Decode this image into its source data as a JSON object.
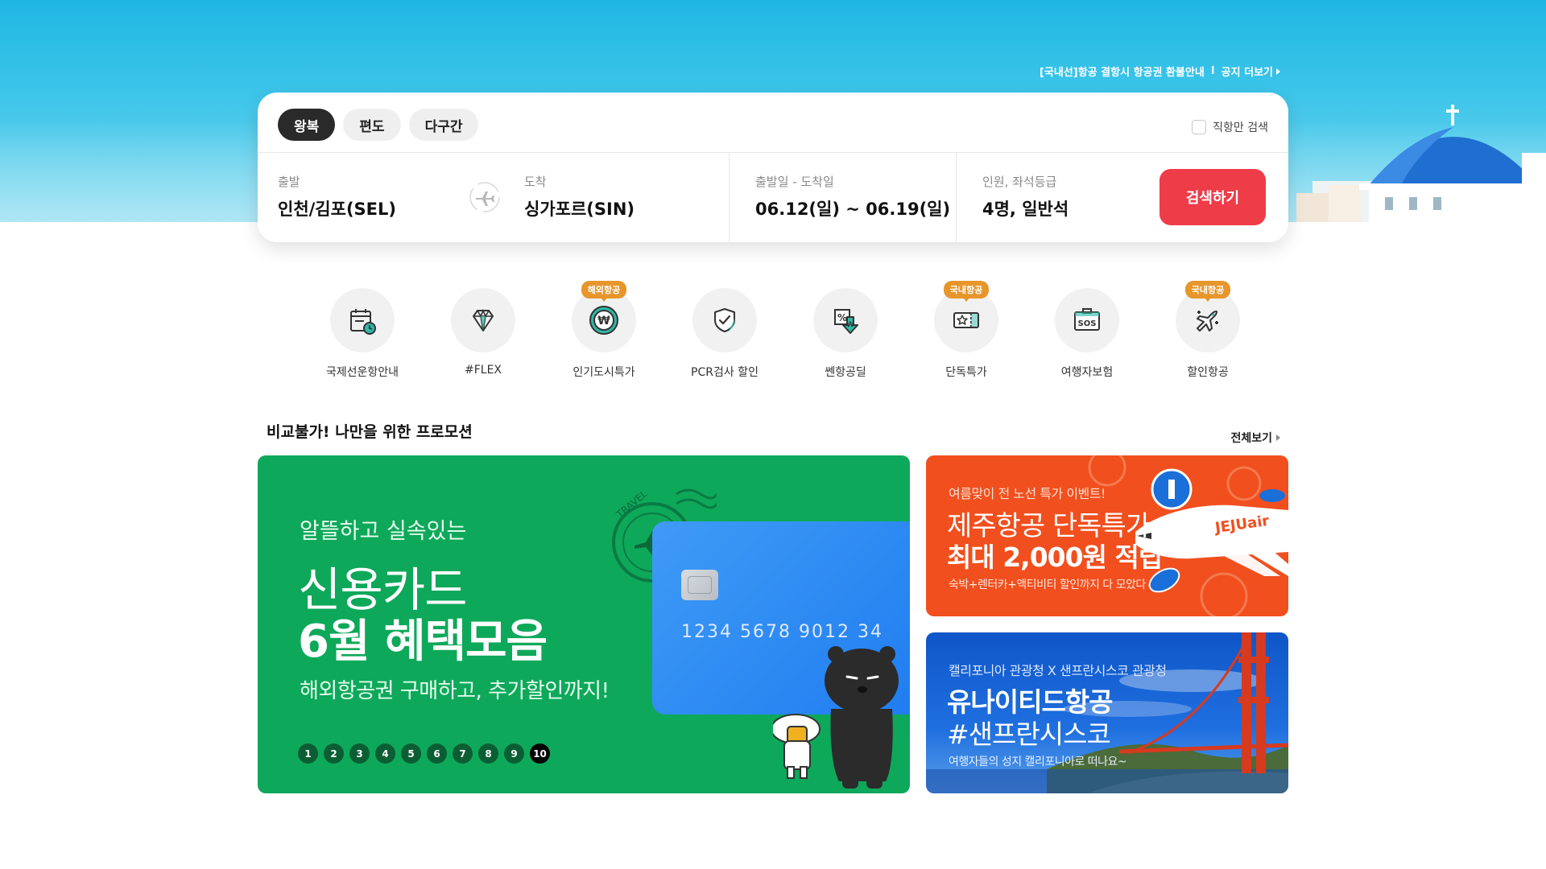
{
  "notice": {
    "text": "[국내선]항공 결항시 항공권 환불안내",
    "separator": "I",
    "more_label": "공지 더보기"
  },
  "search": {
    "tabs": [
      {
        "label": "왕복",
        "active": true
      },
      {
        "label": "편도",
        "active": false
      },
      {
        "label": "다구간",
        "active": false
      }
    ],
    "direct_only_label": "직항만 검색",
    "departure": {
      "label": "출발",
      "value": "인천/김포(SEL)"
    },
    "arrival": {
      "label": "도착",
      "value": "싱가포르(SIN)"
    },
    "dates": {
      "label": "출발일 - 도착일",
      "value": "06.12(일) ~ 06.19(일)"
    },
    "passengers": {
      "label": "인원, 좌석등급",
      "value": "4명, 일반석"
    },
    "search_button": "검색하기",
    "accent_color": "#ee3c49"
  },
  "quick_menu": [
    {
      "label": "국제선운항안내",
      "icon": "calendar-clock-icon",
      "badge": ""
    },
    {
      "label": "#FLEX",
      "icon": "diamond-icon",
      "badge": ""
    },
    {
      "label": "인기도시특가",
      "icon": "won-coin-icon",
      "badge": "해외항공"
    },
    {
      "label": "PCR검사 할인",
      "icon": "shield-check-icon",
      "badge": ""
    },
    {
      "label": "쎈항공딜",
      "icon": "percent-down-icon",
      "badge": ""
    },
    {
      "label": "단독특가",
      "icon": "star-ticket-icon",
      "badge": "국내항공"
    },
    {
      "label": "여행자보험",
      "icon": "sos-icon",
      "badge": ""
    },
    {
      "label": "할인항공",
      "icon": "airplane-sparkle-icon",
      "badge": "국내항공"
    }
  ],
  "promotion": {
    "title": "비교불가! 나만을 위한 프로모션",
    "view_all": "전체보기",
    "main_banner": {
      "subtitle": "알뜰하고 실속있는",
      "title_line1": "신용카드",
      "title_line2": "6월 혜택모음",
      "description": "해외항공권 구매하고, 추가할인까지!",
      "card_number": "1234   5678   9012   34",
      "stamp_text": "TRAVEL",
      "color": "#0ea85a",
      "pages": [
        "1",
        "2",
        "3",
        "4",
        "5",
        "6",
        "7",
        "8",
        "9",
        "10"
      ],
      "active_page": "10"
    },
    "jeju_banner": {
      "subtitle": "여름맞이 전 노선 특가 이벤트!",
      "title_line1": "제주항공 단독특가",
      "title_line2": "최대 2,000원 적립",
      "description": "숙박+렌터카+액티비티 할인까지 다 모았다",
      "plane_text": "JEJUair",
      "color": "#f14f1e"
    },
    "united_banner": {
      "subtitle": "캘리포니아 관광청 X 샌프란시스코 관광청",
      "title_line1": "유나이티드항공",
      "title_line2": "#샌프란시스코",
      "description": "여행자들의 성지 캘리포니아로 떠나요~",
      "color": "#1f6fe0"
    }
  }
}
